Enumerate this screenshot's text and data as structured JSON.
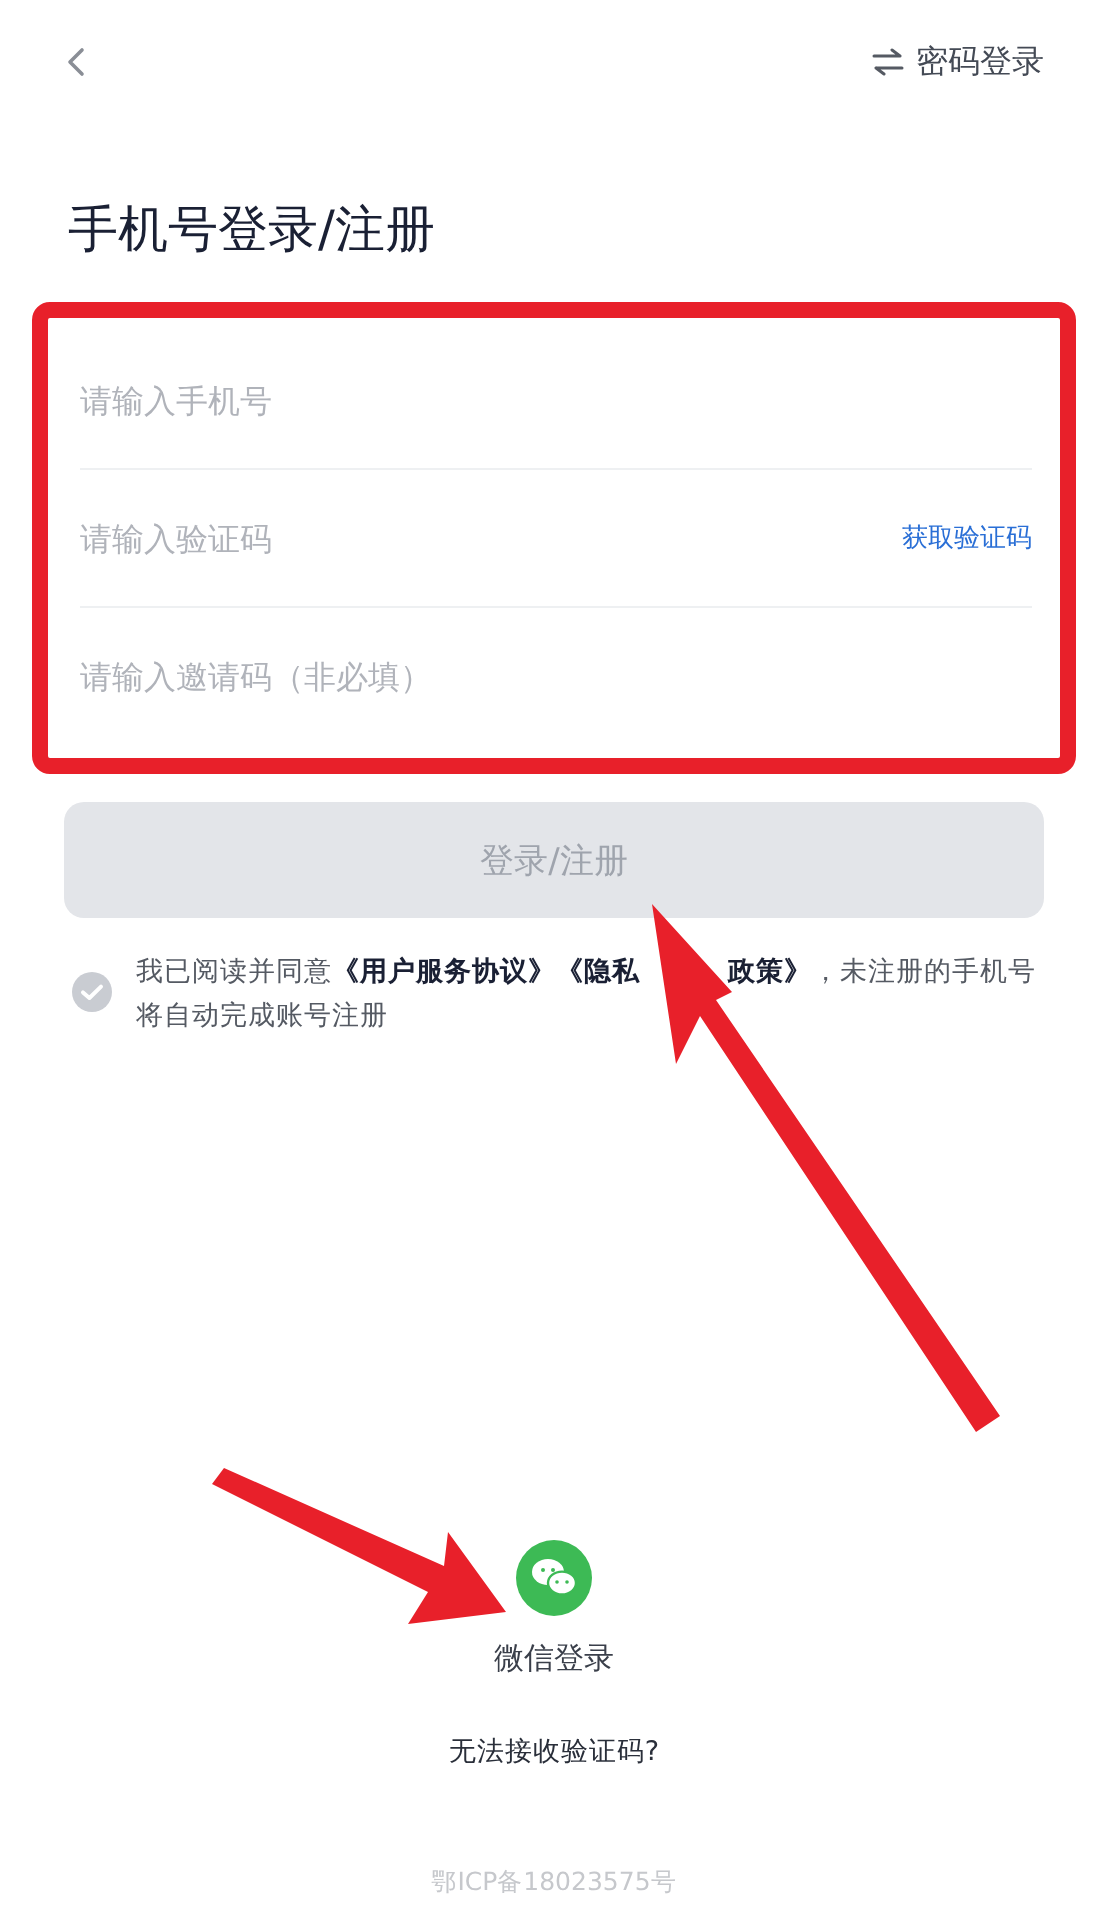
{
  "top_bar": {
    "switch_label": "密码登录"
  },
  "title": "手机号登录/注册",
  "fields": [
    {
      "placeholder": "请输入手机号"
    },
    {
      "placeholder": "请输入验证码",
      "action": "获取验证码"
    },
    {
      "placeholder": "请输入邀请码（非必填）"
    }
  ],
  "submit": {
    "label": "登录/注册",
    "disabled": true
  },
  "consent": {
    "checked": false,
    "prefix": "我已阅读并同意",
    "links": [
      {
        "text": "《用户服务协议》"
      },
      {
        "text": "《隐私",
        "covered_after": true
      },
      {
        "text": "政策》"
      }
    ],
    "suffix": "，未注册的手机号将自动完成账号注册"
  },
  "alt_login": {
    "label": "微信登录"
  },
  "help_link": "无法接收验证码?",
  "footer": "鄂ICP备18023575号",
  "annotations": [
    {
      "kind": "box"
    },
    {
      "kind": "arrow"
    },
    {
      "kind": "arrow"
    }
  ]
}
